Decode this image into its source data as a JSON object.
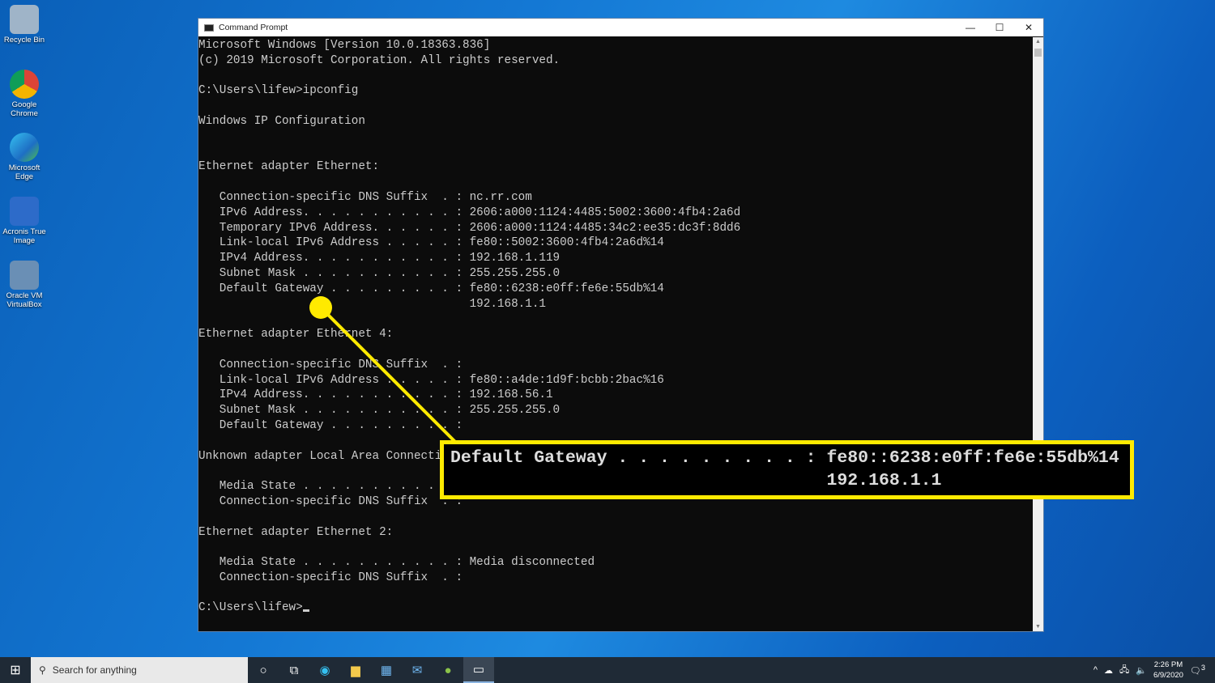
{
  "desktop": {
    "icons": [
      {
        "label": "Recycle Bin",
        "icon": "recycle-bin-icon",
        "color": "#9fb4c8"
      },
      {
        "label": "Google Chrome",
        "icon": "chrome-icon",
        "color": "#db4437"
      },
      {
        "label": "Microsoft Edge",
        "icon": "edge-icon",
        "color": "#2fa3d9"
      },
      {
        "label": "Acronis True Image",
        "icon": "acronis-icon",
        "color": "#2d6bc9"
      },
      {
        "label": "Oracle VM VirtualBox",
        "icon": "virtualbox-icon",
        "color": "#6a8fb5"
      }
    ]
  },
  "window": {
    "title": "Command Prompt",
    "minimize": "—",
    "maximize": "☐",
    "close": "✕"
  },
  "terminal": {
    "lines": [
      "Microsoft Windows [Version 10.0.18363.836]",
      "(c) 2019 Microsoft Corporation. All rights reserved.",
      "",
      "C:\\Users\\lifew>ipconfig",
      "",
      "Windows IP Configuration",
      "",
      "",
      "Ethernet adapter Ethernet:",
      "",
      "   Connection-specific DNS Suffix  . : nc.rr.com",
      "   IPv6 Address. . . . . . . . . . . : 2606:a000:1124:4485:5002:3600:4fb4:2a6d",
      "   Temporary IPv6 Address. . . . . . : 2606:a000:1124:4485:34c2:ee35:dc3f:8dd6",
      "   Link-local IPv6 Address . . . . . : fe80::5002:3600:4fb4:2a6d%14",
      "   IPv4 Address. . . . . . . . . . . : 192.168.1.119",
      "   Subnet Mask . . . . . . . . . . . : 255.255.255.0",
      "   Default Gateway . . . . . . . . . : fe80::6238:e0ff:fe6e:55db%14",
      "                                       192.168.1.1",
      "",
      "Ethernet adapter Ethernet 4:",
      "",
      "   Connection-specific DNS Suffix  . :",
      "   Link-local IPv6 Address . . . . . : fe80::a4de:1d9f:bcbb:2bac%16",
      "   IPv4 Address. . . . . . . . . . . : 192.168.56.1",
      "   Subnet Mask . . . . . . . . . . . : 255.255.255.0",
      "   Default Gateway . . . . . . . . . :",
      "",
      "Unknown adapter Local Area Connecti",
      "",
      "   Media State . . . . . . . . . . .",
      "   Connection-specific DNS Suffix  . :",
      "",
      "Ethernet adapter Ethernet 2:",
      "",
      "   Media State . . . . . . . . . . . : Media disconnected",
      "   Connection-specific DNS Suffix  . :",
      ""
    ],
    "prompt": "C:\\Users\\lifew>"
  },
  "callout": {
    "line1": "Default Gateway . . . . . . . . . : fe80::6238:e0ff:fe6e:55db%14",
    "line2": "                                    192.168.1.1",
    "color": "#ffea00"
  },
  "taskbar": {
    "search_placeholder": "Search for anything",
    "time": "2:26 PM",
    "date": "6/9/2020",
    "notifications": "3"
  }
}
